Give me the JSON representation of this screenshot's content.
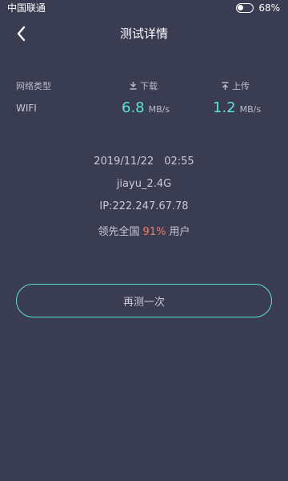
{
  "status_bar": {
    "carrier": "中国联通",
    "battery": "68%"
  },
  "header": {
    "title": "测试详情"
  },
  "table": {
    "headers": {
      "type": "网络类型",
      "download": "下载",
      "upload": "上传"
    },
    "row": {
      "type": "WIFI",
      "download_value": "6.8",
      "download_unit": "MB/s",
      "upload_value": "1.2",
      "upload_unit": "MB/s"
    }
  },
  "details": {
    "date": "2019/11/22",
    "time": "02:55",
    "ssid": "jiayu_2.4G",
    "ip": "IP:222.247.67.78",
    "rank_prefix": "领先全国",
    "rank_percent": "91%",
    "rank_suffix": "用户"
  },
  "actions": {
    "retest": "再测一次"
  },
  "colors": {
    "background": "#3a3c52",
    "accent": "#5ce3d8",
    "highlight": "#f07d66"
  },
  "icons": {
    "back": "chevron-left-icon",
    "download": "download-icon",
    "upload": "upload-icon",
    "battery": "battery-icon"
  }
}
